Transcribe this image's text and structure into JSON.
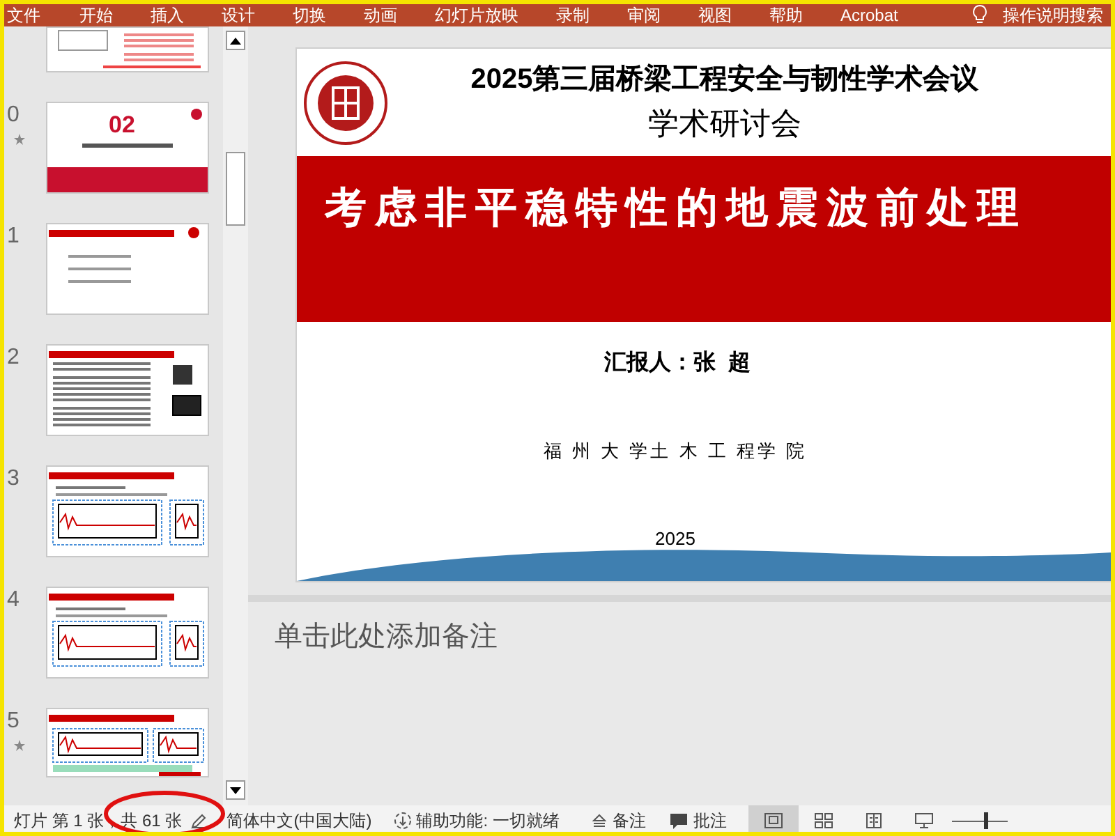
{
  "menu": [
    {
      "label": "文件",
      "kind": "text"
    },
    {
      "label": "开始",
      "kind": "text"
    },
    {
      "label": "插入",
      "kind": "text"
    },
    {
      "label": "设计",
      "kind": "text"
    },
    {
      "label": "切换",
      "kind": "text"
    },
    {
      "label": "动画",
      "kind": "text"
    },
    {
      "label": "幻灯片放映",
      "kind": "text"
    },
    {
      "label": "录制",
      "kind": "text"
    },
    {
      "label": "审阅",
      "kind": "text"
    },
    {
      "label": "视图",
      "kind": "text"
    },
    {
      "label": "帮助",
      "kind": "text"
    },
    {
      "label": "Acrobat",
      "kind": "text"
    },
    {
      "label": "操作说明搜索",
      "kind": "search"
    }
  ],
  "thumbnails": [
    {
      "kind": "text",
      "animated": false
    },
    {
      "number": "0",
      "kind": "section",
      "heading": "02",
      "animated": true
    },
    {
      "number": "1",
      "kind": "list",
      "animated": false
    },
    {
      "number": "2",
      "kind": "figures",
      "animated": false
    },
    {
      "number": "3",
      "kind": "charts",
      "animated": false
    },
    {
      "number": "4",
      "kind": "charts",
      "animated": false
    },
    {
      "number": "5",
      "kind": "table",
      "animated": true
    }
  ],
  "slide": {
    "line1": "2025第三届桥梁工程安全与韧性学术会议",
    "line2": "学术研讨会",
    "title": "考虑非平稳特性的地震波前处理",
    "presenter": "汇报人：张  超",
    "institution": "福 州 大 学土 木 工 程学 院",
    "year": "2025"
  },
  "notes": {
    "placeholder": "单击此处添加备注"
  },
  "status_bar": {
    "slide_info": "灯片 第 1 张，共 61 张",
    "language": "简体中文(中国大陆)",
    "accessibility": "辅助功能: 一切就绪",
    "notes": "备注",
    "comments": "批注",
    "zoom": {
      "level": 0.6
    },
    "views": [
      {
        "kind": "normal",
        "selected": true
      },
      {
        "kind": "sorter",
        "selected": false
      },
      {
        "kind": "reading",
        "selected": false
      },
      {
        "kind": "show",
        "selected": false
      }
    ]
  }
}
